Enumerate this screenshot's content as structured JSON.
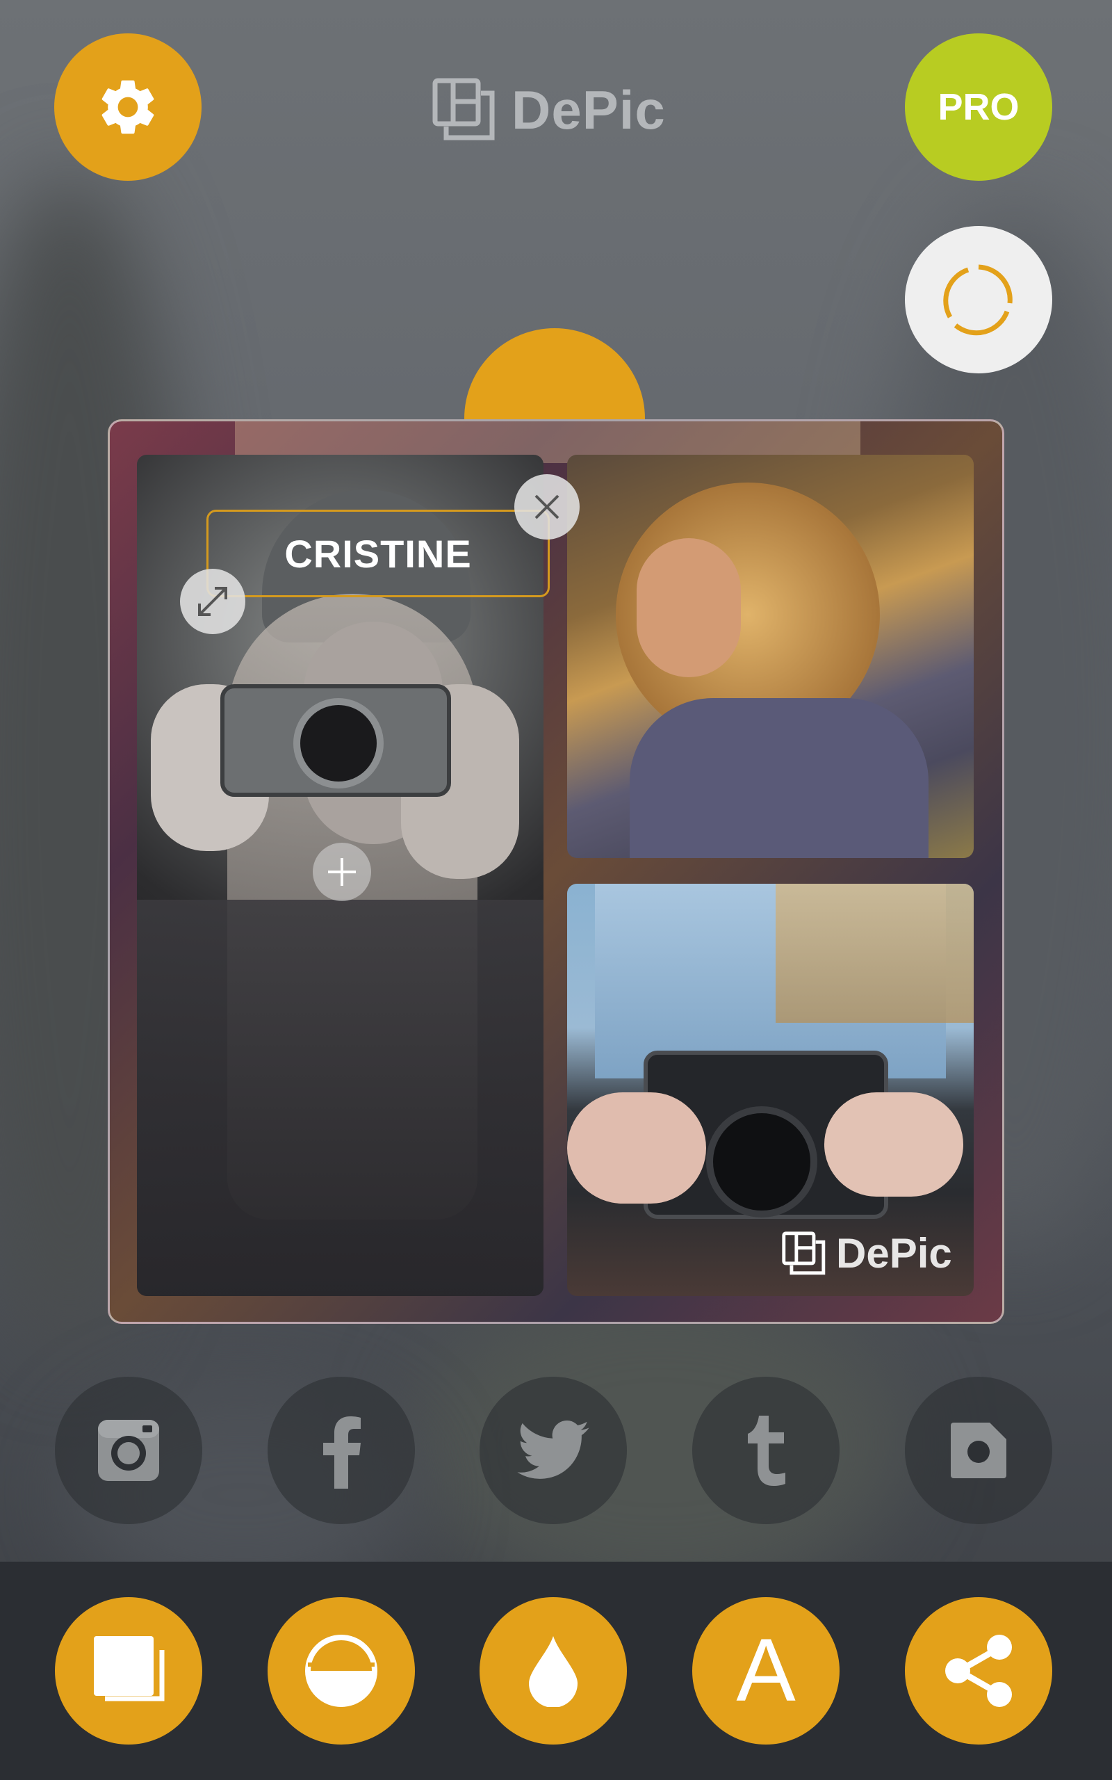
{
  "app": {
    "title": "DePic",
    "watermark": "DePic"
  },
  "header": {
    "settings_icon": "gear-icon",
    "pro_label": "PRO",
    "refresh_icon": "refresh-icon"
  },
  "collage": {
    "caption_text": "CRISTINE",
    "close_icon": "close-icon",
    "resize_icon": "resize-icon",
    "add_icon": "plus-icon"
  },
  "share_row": [
    {
      "name": "instagram",
      "icon": "instagram-icon"
    },
    {
      "name": "facebook",
      "icon": "facebook-icon"
    },
    {
      "name": "twitter",
      "icon": "twitter-icon"
    },
    {
      "name": "tumblr",
      "icon": "tumblr-icon"
    },
    {
      "name": "save",
      "icon": "save-file-icon"
    }
  ],
  "toolbar": [
    {
      "name": "layout",
      "icon": "layers-icon"
    },
    {
      "name": "filter",
      "icon": "half-circle-icon"
    },
    {
      "name": "adjust",
      "icon": "drop-icon"
    },
    {
      "name": "text",
      "icon": "text-icon",
      "label": "A"
    },
    {
      "name": "share",
      "icon": "share-icon"
    }
  ],
  "colors": {
    "accent": "#e3a11a",
    "pro": "#b8cc22",
    "bar": "#2b2e33"
  }
}
